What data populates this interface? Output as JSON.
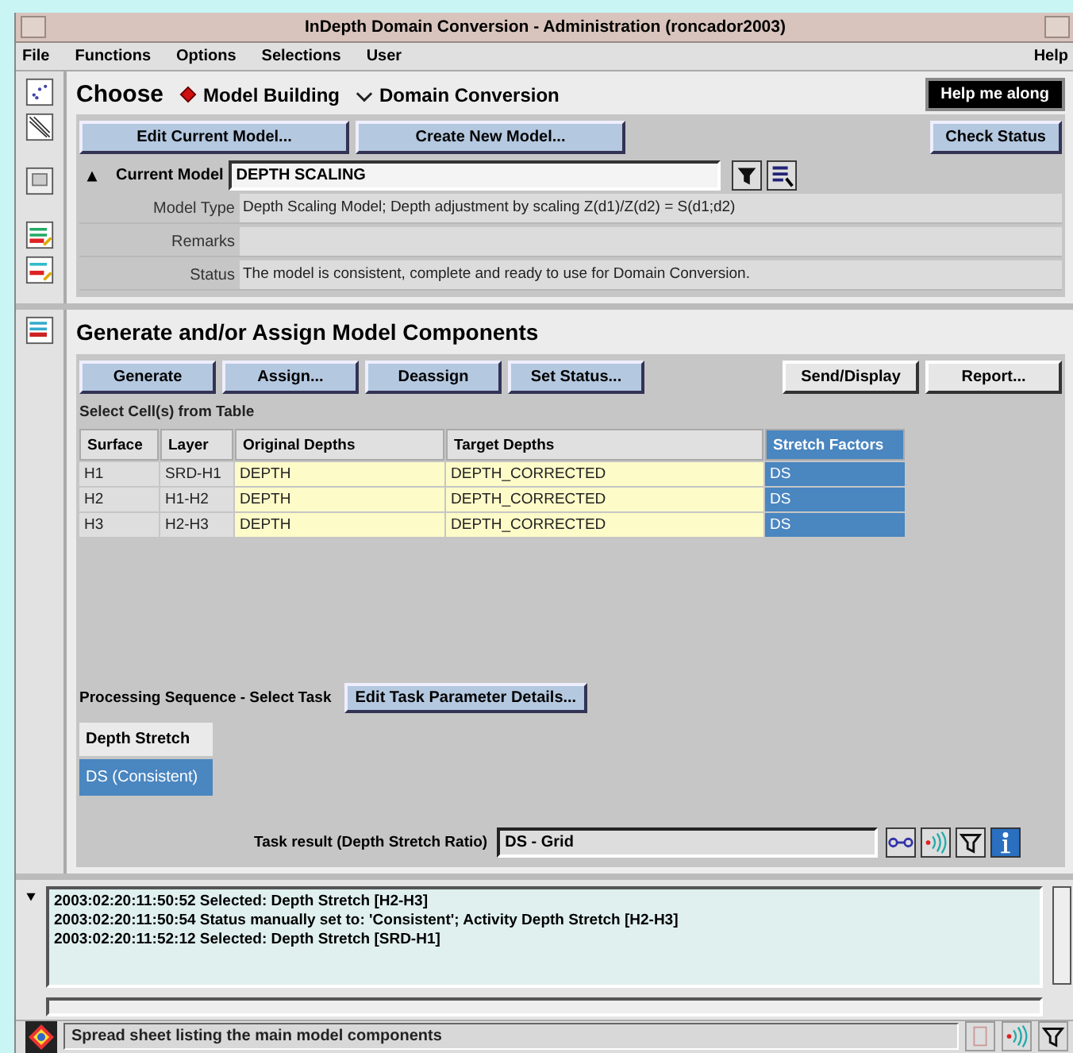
{
  "window": {
    "title": "InDepth Domain Conversion - Administration (roncador2003)"
  },
  "menu": [
    {
      "label": "File"
    },
    {
      "label": "Functions"
    },
    {
      "label": "Options"
    },
    {
      "label": "Selections"
    },
    {
      "label": "User"
    }
  ],
  "help_menu": "Help",
  "choose": {
    "label": "Choose",
    "options": [
      {
        "label": "Model Building",
        "selected": true
      },
      {
        "label": "Domain Conversion",
        "selected": false
      }
    ]
  },
  "help_button": "Help me along",
  "model_buttons": [
    "Edit Current Model...",
    "Create New Model..."
  ],
  "check_status_button": "Check Status",
  "current_model": {
    "label": "Current Model",
    "value": "DEPTH SCALING"
  },
  "info_rows": [
    {
      "label": "Model Type",
      "value": "Depth Scaling Model; Depth adjustment by scaling Z(d1)/Z(d2) = S(d1;d2)"
    },
    {
      "label": "Remarks"
    },
    {
      "label": "Status",
      "value": "The model is consistent, complete and ready to use for Domain Conversion."
    }
  ],
  "components": {
    "title": "Generate and/or Assign Model Components",
    "action_buttons": [
      "Generate",
      "Assign...",
      "Deassign",
      "Set Status..."
    ],
    "right_buttons": [
      "Send/Display",
      "Report..."
    ],
    "hint": "Select Cell(s) from Table",
    "table": {
      "columns": [
        {
          "label": "Surface",
          "selected": false
        },
        {
          "label": "Layer",
          "selected": false
        },
        {
          "label": "Original Depths",
          "selected": false
        },
        {
          "label": "Target Depths",
          "selected": false
        },
        {
          "label": "Stretch Factors",
          "selected": true
        }
      ],
      "rows": [
        [
          "H1",
          "SRD-H1",
          "DEPTH",
          "DEPTH_CORRECTED",
          "DS"
        ],
        [
          "H2",
          "H1-H2",
          "DEPTH",
          "DEPTH_CORRECTED",
          "DS"
        ],
        [
          "H3",
          "H2-H3",
          "DEPTH",
          "DEPTH_CORRECTED",
          "DS"
        ]
      ]
    },
    "processing_label": "Processing Sequence - Select Task",
    "processing_button": "Edit Task Parameter Details...",
    "task_header": "Depth Stretch",
    "tasks": [
      {
        "label": "DS (Consistent)",
        "selected": true
      }
    ],
    "task_result": {
      "label": "Task result (Depth Stretch Ratio)",
      "value": "DS - Grid"
    }
  },
  "log": [
    "2003:02:20:11:50:52 Selected: Depth Stretch [H2-H3]",
    "2003:02:20:11:50:54 Status manually set to: 'Consistent'; Activity Depth Stretch [H2-H3]",
    "2003:02:20:11:52:12 Selected: Depth Stretch [SRD-H1]"
  ],
  "status_bar": "Spread sheet listing the main model components"
}
